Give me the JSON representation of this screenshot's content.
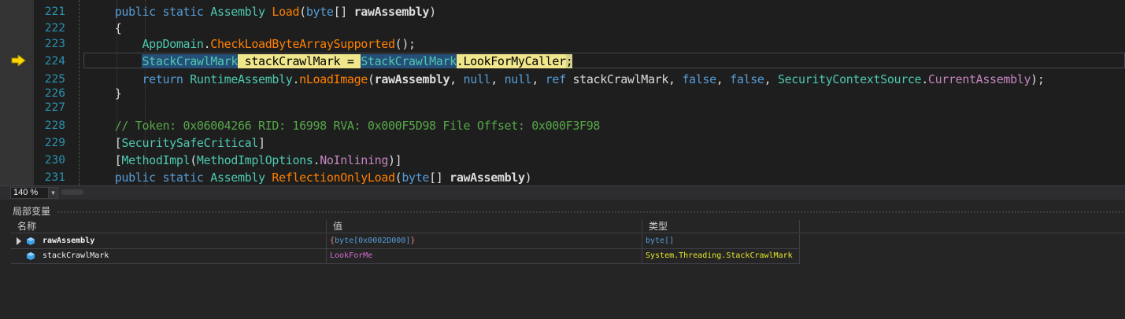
{
  "editor": {
    "lines": [
      {
        "num": "221",
        "parts": [
          [
            "kw",
            "public "
          ],
          [
            "kw",
            "static "
          ],
          [
            "ty",
            "Assembly "
          ],
          [
            "mth",
            "Load"
          ],
          [
            "var",
            "("
          ],
          [
            "kw",
            "byte"
          ],
          [
            "var",
            "[] "
          ],
          [
            "bold",
            "rawAssembly"
          ],
          [
            "var",
            ")"
          ]
        ]
      },
      {
        "num": "222",
        "parts": [
          [
            "var",
            "{"
          ]
        ]
      },
      {
        "num": "223",
        "parts": [
          [
            "ty",
            "    AppDomain"
          ],
          [
            "var",
            "."
          ],
          [
            "mth",
            "CheckLoadByteArraySupported"
          ],
          [
            "var",
            "();"
          ]
        ]
      },
      {
        "num": "224",
        "parts": []
      },
      {
        "num": "225",
        "parts": [
          [
            "kw",
            "    return "
          ],
          [
            "ty",
            "RuntimeAssembly"
          ],
          [
            "var",
            "."
          ],
          [
            "mth",
            "nLoadImage"
          ],
          [
            "var",
            "("
          ],
          [
            "bold",
            "rawAssembly"
          ],
          [
            "var",
            ", "
          ],
          [
            "kw",
            "null"
          ],
          [
            "var",
            ", "
          ],
          [
            "kw",
            "null"
          ],
          [
            "var",
            ", "
          ],
          [
            "kw",
            "ref "
          ],
          [
            "var",
            "stackCrawlMark, "
          ],
          [
            "kw",
            "false"
          ],
          [
            "var",
            ", "
          ],
          [
            "kw",
            "false"
          ],
          [
            "var",
            ", "
          ],
          [
            "ty",
            "SecurityContextSource"
          ],
          [
            "var",
            "."
          ],
          [
            "pur",
            "CurrentAssembly"
          ],
          [
            "var",
            ");"
          ]
        ]
      },
      {
        "num": "226",
        "parts": [
          [
            "var",
            "}"
          ]
        ]
      },
      {
        "num": "227",
        "parts": []
      },
      {
        "num": "228",
        "parts": [
          [
            "cmt",
            "// Token: 0x06004266 RID: 16998 RVA: 0x000F5D98 File Offset: 0x000F3F98"
          ]
        ]
      },
      {
        "num": "229",
        "parts": [
          [
            "var",
            "["
          ],
          [
            "ty",
            "SecuritySafeCritical"
          ],
          [
            "var",
            "]"
          ]
        ]
      },
      {
        "num": "230",
        "parts": [
          [
            "var",
            "["
          ],
          [
            "ty",
            "MethodImpl"
          ],
          [
            "var",
            "("
          ],
          [
            "ty",
            "MethodImplOptions"
          ],
          [
            "var",
            "."
          ],
          [
            "pur",
            "NoInlining"
          ],
          [
            "var",
            ")]"
          ]
        ]
      },
      {
        "num": "231",
        "parts": [
          [
            "kw",
            "public "
          ],
          [
            "kw",
            "static "
          ],
          [
            "ty",
            "Assembly "
          ],
          [
            "mth",
            "ReflectionOnlyLoad"
          ],
          [
            "var",
            "("
          ],
          [
            "kw",
            "byte"
          ],
          [
            "var",
            "[] "
          ],
          [
            "bold",
            "rawAssembly"
          ],
          [
            "var",
            ")"
          ]
        ]
      }
    ],
    "current_line": {
      "type1": "StackCrawlMark",
      "middle": " stackCrawlMark = ",
      "type2": "StackCrawlMark",
      "dot": ".",
      "member": "LookForMyCaller",
      "semi": ";"
    }
  },
  "status": {
    "zoom": "140 %"
  },
  "locals": {
    "title": "局部变量",
    "columns": [
      "名称",
      "值",
      "类型"
    ],
    "rows": [
      {
        "name": "rawAssembly",
        "value": "{byte[0x0002D000]}",
        "type": "byte[]",
        "expandable": true
      },
      {
        "name": "stackCrawlMark",
        "value": "LookForMe",
        "type": "System.Threading.StackCrawlMark",
        "expandable": false
      }
    ]
  },
  "colors": {
    "keyword": "#569cd6",
    "type": "#4ec9b0",
    "method": "#ff8000",
    "comment": "#57a64a",
    "enum_member": "#c586c0",
    "line_number": "#2b91af",
    "current_statement": "#f0e68c"
  },
  "icons": [
    "execution-pointer-arrow-icon",
    "expand-arrow-icon",
    "local-variable-cube-icon",
    "chevron-down-icon"
  ]
}
